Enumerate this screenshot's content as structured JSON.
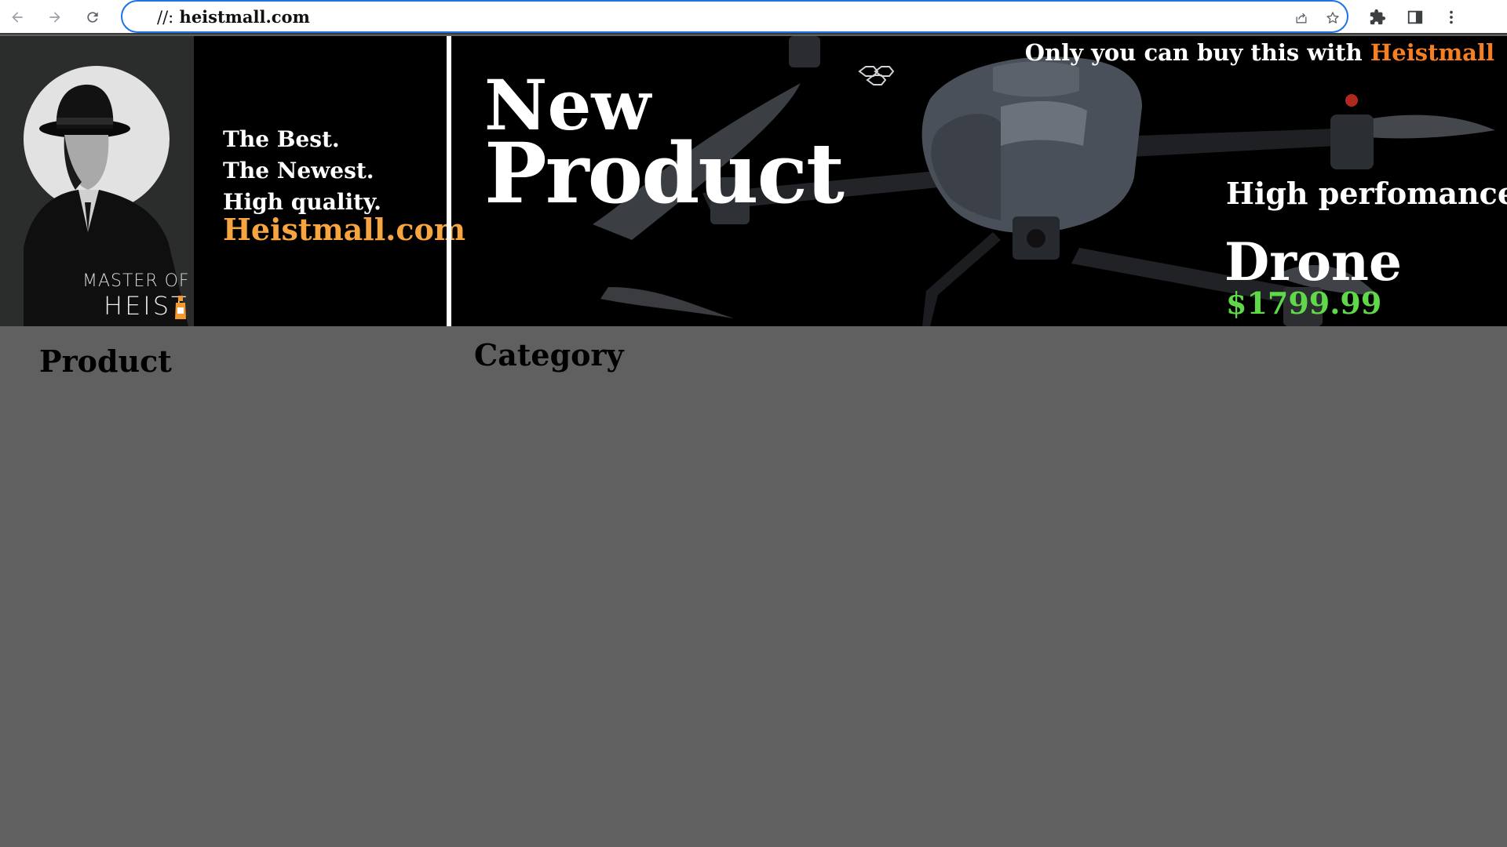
{
  "browser": {
    "url_scheme": "//:",
    "url_host": "heistmall.com",
    "icons": [
      "back-icon",
      "forward-icon",
      "reload-icon",
      "share-icon",
      "bookmark-star-icon",
      "extensions-icon",
      "side-panel-icon",
      "more-menu-icon"
    ]
  },
  "banner": {
    "logo": {
      "line1": "MASTER OF",
      "line2": "HEIST"
    },
    "taglines": [
      "The Best.",
      "The Newest.",
      "High quality."
    ],
    "site": "Heistmall.com",
    "headline_new": "New",
    "headline_product": "Product",
    "promo_prefix": "Only you can buy this with",
    "promo_brand": "Heistmall",
    "feature": "High perfomance",
    "item_name": "Drone",
    "price": "$1799.99",
    "colors": {
      "orange": "#f7a541",
      "promo_orange": "#f57f23",
      "price_green": "#5fd84a"
    }
  },
  "content": {
    "product_heading": "Product",
    "category_heading": "Category",
    "background": "#606060"
  }
}
